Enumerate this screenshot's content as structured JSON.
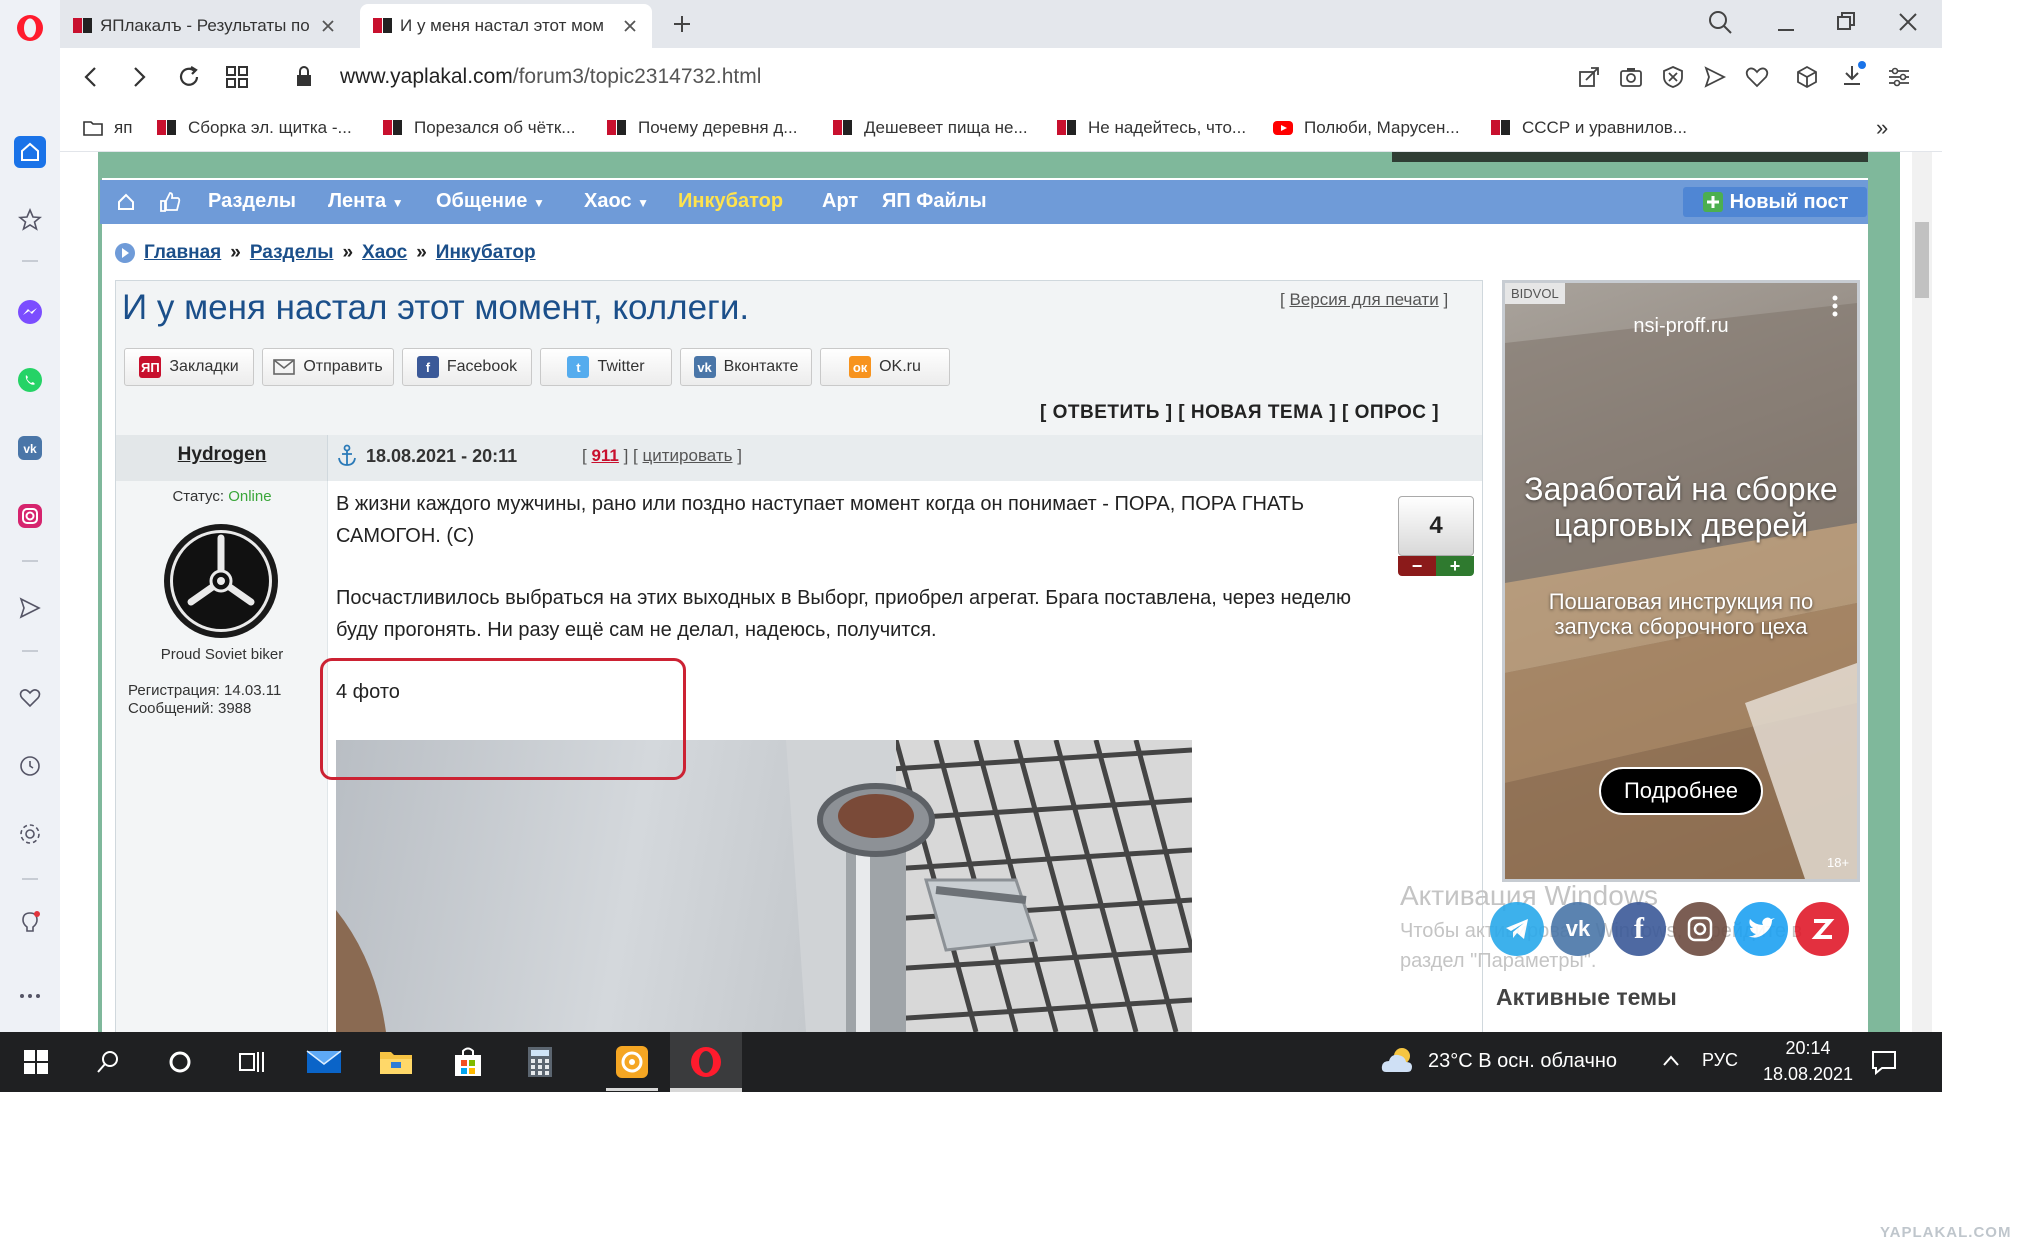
{
  "browser": {
    "tabs": [
      {
        "title": "ЯПлакалъ - Результаты по",
        "active": false
      },
      {
        "title": "И у меня настал этот мом",
        "active": true
      }
    ],
    "new_tab_label": "+",
    "url_host": "www.yaplakal.com",
    "url_path": "/forum3/topic2314732.html"
  },
  "bookmarks": [
    {
      "label": "яп",
      "icon": "folder-icon"
    },
    {
      "label": "Сборка эл. щитка -...",
      "icon": "yap-icon"
    },
    {
      "label": "Порезался об чётк...",
      "icon": "yap-icon"
    },
    {
      "label": "Почему деревня д...",
      "icon": "yap-icon"
    },
    {
      "label": "Дешевеет пища не...",
      "icon": "yap-icon"
    },
    {
      "label": "Не надейтесь, что...",
      "icon": "yap-icon"
    },
    {
      "label": "Полюби, Марусен...",
      "icon": "youtube-icon"
    },
    {
      "label": "СССР и уравнилов...",
      "icon": "yap-icon"
    }
  ],
  "bookmarks_more": "»",
  "site_nav": {
    "items": [
      "Разделы",
      "Лента",
      "Общение",
      "Хаос",
      "Инкубатор",
      "Арт",
      "ЯП Файлы"
    ],
    "new_post": "Новый пост"
  },
  "breadcrumb": {
    "items": [
      "Главная",
      "Разделы",
      "Хаос",
      "Инкубатор"
    ],
    "sep": "»"
  },
  "topic": {
    "title": "И у меня настал этот момент, коллеги.",
    "print_version": "Версия для печати",
    "share": [
      "Закладки",
      "Отправить",
      "Facebook",
      "Twitter",
      "Вконтакте",
      "OK.ru"
    ],
    "actions": "[ ОТВЕТИТЬ ] [ НОВАЯ ТЕМА ] [ ОПРОС ]"
  },
  "post": {
    "author": "Hydrogen",
    "status_label": "Статус:",
    "status_value": "Online",
    "user_title": "Proud Soviet biker",
    "registration": "Регистрация: 14.03.11",
    "messages": "Сообщений: 3988",
    "datetime": "18.08.2021 - 20:11",
    "post_number": "911",
    "quote": "цитировать",
    "rating": "4",
    "paragraph1": "В жизни каждого мужчины, рано или поздно наступает момент когда он понимает - ПОРА, ПОРА ГНАТЬ САМОГОН. (С)",
    "paragraph2": "Посчастливилось выбраться на этих выходных в Выборг, приобрел агрегат. Брага поставлена, через неделю буду прогонять. Ни разу ещё сам не делал, надеюсь, получится.",
    "photos": "4 фото"
  },
  "ad": {
    "label": "BIDVOL",
    "domain": "nsi-proff.ru",
    "headline": "Заработай на сборке царговых дверей",
    "sub": "Пошаговая инструкция по запуска сборочного цеха",
    "cta": "Подробнее",
    "age": "18+"
  },
  "active_topics": "Активные темы",
  "windows_activation": {
    "title": "Активация Windows",
    "line1": "Чтобы активировать Windows, перейдите в",
    "line2": "раздел \"Параметры\"."
  },
  "taskbar": {
    "weather": "23°C  В осн. облачно",
    "lang": "РУС",
    "time": "20:14",
    "date": "18.08.2021"
  },
  "watermark": "YAPLAKAL.COM",
  "colors": {
    "nav_blue": "#6f9bd8",
    "frame_green": "#7fb89b",
    "link_blue": "#1b4f8a",
    "highlight_red": "#cc2233",
    "incubator_yellow": "#ffe34d"
  }
}
